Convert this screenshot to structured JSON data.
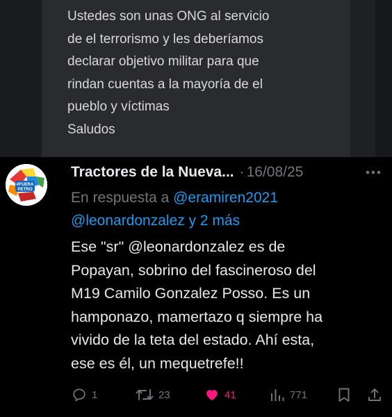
{
  "parent_tweet": {
    "lines": [
      "Ustedes son unas ONG al servicio",
      "de el terrorismo y les deberíamos",
      "declarar objetivo militar para que",
      "rindan cuentas a la mayoría de el",
      "pueblo y víctimas",
      "Saludos"
    ]
  },
  "tweet": {
    "avatar_text": "#FUERA PETRO",
    "author": "Tractores de la Nueva...",
    "separator": "·",
    "date": "16/08/25",
    "reply_prefix": "En respuesta a",
    "reply_mention_1": "@eramiren2021",
    "reply_mention_2": "@leonardonzalez y 2 más",
    "body_lines": [
      "Ese \"sr\" @leonardonzalez es de",
      "Popayan, sobrino del fascineroso del",
      "M19 Camilo Gonzalez Posso. Es un",
      "hamponazo, mamertazo q siempre ha",
      "vivido de la teta del estado. Ahí esta,",
      "ese es él, un mequetrefe!!"
    ],
    "actions": {
      "replies": "1",
      "reposts": "23",
      "likes": "41",
      "views": "771"
    }
  },
  "colors": {
    "background": "#000000",
    "text": "#e7e9ea",
    "muted": "#71767b",
    "link": "#1d9bf0",
    "like": "#f91880"
  },
  "icons": [
    "reply-icon",
    "repost-icon",
    "heart-icon",
    "views-icon",
    "bookmark-icon",
    "share-icon",
    "more-icon"
  ]
}
